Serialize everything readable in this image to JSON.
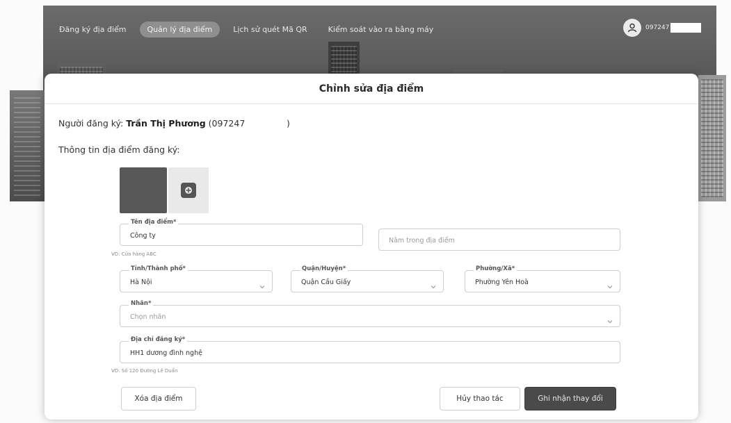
{
  "nav": {
    "items": [
      {
        "label": "Đăng ký địa điểm",
        "active": false
      },
      {
        "label": "Quản lý địa điểm",
        "active": true
      },
      {
        "label": "Lịch sử quét Mã QR",
        "active": false
      },
      {
        "label": "Kiểm soát vào ra bằng máy",
        "active": false
      }
    ]
  },
  "user": {
    "phone": "097247",
    "icon": "user-icon"
  },
  "modal": {
    "title": "Chỉnh sửa địa điểm",
    "registrant_label": "Người đăng ký:",
    "registrant_name": "Trần Thị Phương",
    "registrant_phone": "(097247",
    "registrant_close": ")",
    "section_title": "Thông tin địa điểm đăng ký:",
    "photo_add_icon": "add-photo-icon"
  },
  "form": {
    "name": {
      "label": "Tên địa điểm*",
      "value": "Công ty",
      "hint": "VD: Cửa hàng ABC"
    },
    "within": {
      "placeholder": "Nằm trong địa điểm"
    },
    "province": {
      "label": "Tỉnh/Thành phố*",
      "value": "Hà Nội"
    },
    "district": {
      "label": "Quận/Huyện*",
      "value": "Quận Cầu Giấy"
    },
    "ward": {
      "label": "Phường/Xã*",
      "value": "Phường Yên Hoà"
    },
    "tag": {
      "label": "Nhãn*",
      "placeholder": "Chọn nhãn"
    },
    "address": {
      "label": "Địa chỉ đăng ký*",
      "value": "HH1 dương đình nghệ",
      "hint": "VD: Số 120 Đường Lê Duẩn"
    }
  },
  "buttons": {
    "delete": "Xóa địa điểm",
    "cancel": "Hủy thao tác",
    "save": "Ghi nhận thay đổi"
  },
  "colors": {
    "nav_active": "#8f8f8f",
    "primary_button": "#4a4a4a"
  }
}
